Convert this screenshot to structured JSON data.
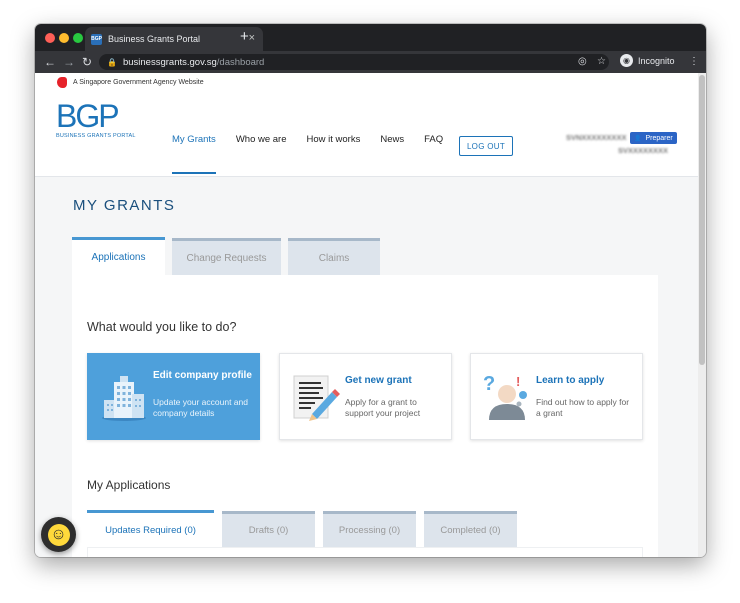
{
  "browser": {
    "tab_title": "Business Grants Portal",
    "favicon_text": "BGP",
    "tab_close": "×",
    "new_tab": "+",
    "back": "←",
    "forward": "→",
    "reload": "↻",
    "lock": "🔒",
    "url_host": "businessgrants.gov.sg",
    "url_path": "/dashboard",
    "eye_icon": "◎",
    "star_icon": "☆",
    "incognito_label": "Incognito",
    "incognito_glyph": "◉",
    "menu_dots": "⋮"
  },
  "gov_banner": {
    "text": "A Singapore Government Agency Website"
  },
  "logo": {
    "letters": "BGP",
    "subtitle": "BUSINESS GRANTS PORTAL"
  },
  "nav": {
    "items": [
      {
        "label": "My Grants",
        "active": true
      },
      {
        "label": "Who we are",
        "active": false
      },
      {
        "label": "How it works",
        "active": false
      },
      {
        "label": "News",
        "active": false
      },
      {
        "label": "FAQ",
        "active": false
      }
    ],
    "logout_label": "LOG OUT"
  },
  "user": {
    "name": "SVNXXXXXXXXX",
    "role": "Preparer",
    "role_glyph": "👤",
    "org": "SVXXXXXXXX"
  },
  "page": {
    "title": "MY GRANTS"
  },
  "main_tabs": [
    {
      "label": "Applications",
      "active": true
    },
    {
      "label": "Change Requests",
      "active": false
    },
    {
      "label": "Claims",
      "active": false
    }
  ],
  "actions": {
    "heading": "What would you like to do?",
    "cards": [
      {
        "title": "Edit company profile",
        "desc": "Update your account and company details",
        "icon": "building-icon"
      },
      {
        "title": "Get new grant",
        "desc": "Apply for a grant to support your project",
        "icon": "document-pencil-icon"
      },
      {
        "title": "Learn to apply",
        "desc": "Find out how to apply for a grant",
        "icon": "person-question-icon"
      }
    ]
  },
  "applications": {
    "heading": "My Applications",
    "tabs": [
      {
        "label": "Updates Required (0)",
        "active": true
      },
      {
        "label": "Drafts (0)",
        "active": false
      },
      {
        "label": "Processing (0)",
        "active": false
      },
      {
        "label": "Completed (0)",
        "active": false
      }
    ]
  },
  "chat": {
    "glyph": "☺"
  },
  "colors": {
    "brand_blue": "#1c73b8",
    "primary_card": "#4ea0db",
    "title_navy": "#1a4f7d",
    "preparer_badge": "#2b64c5"
  }
}
